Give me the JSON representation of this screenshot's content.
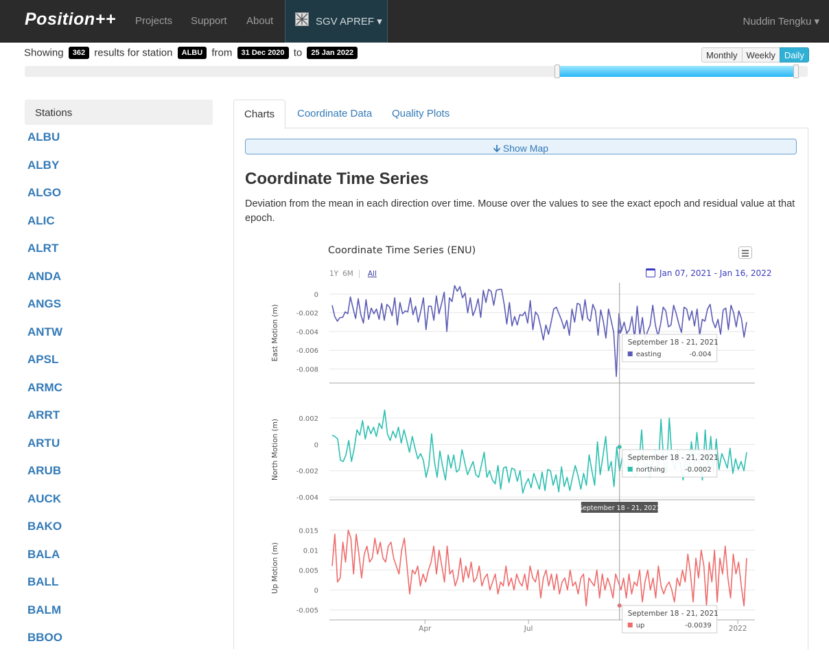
{
  "navbar": {
    "brand": "Position++",
    "links": [
      "Projects",
      "Support",
      "About"
    ],
    "active_menu": "SGV APREF",
    "user": "Nuddin Tengku"
  },
  "filter": {
    "prefix": "Showing",
    "count": "362",
    "mid1": "results for station",
    "station": "ALBU",
    "mid2": "from",
    "from": "31 Dec 2020",
    "mid3": "to",
    "to": "25 Jan 2022",
    "granularity": [
      "Monthly",
      "Weekly",
      "Daily"
    ],
    "selected_granularity": "Daily",
    "range_selected_fraction": [
      0.68,
      0.985
    ]
  },
  "sidebar": {
    "header": "Stations",
    "stations": [
      "ALBU",
      "ALBY",
      "ALGO",
      "ALIC",
      "ALRT",
      "ANDA",
      "ANGS",
      "ANTW",
      "APSL",
      "ARMC",
      "ARRT",
      "ARTU",
      "ARUB",
      "AUCK",
      "BAKO",
      "BALA",
      "BALL",
      "BALM",
      "BBOO"
    ]
  },
  "tabs": [
    "Charts",
    "Coordinate Data",
    "Quality Plots"
  ],
  "active_tab": "Charts",
  "map_button": "Show Map",
  "main": {
    "title": "Coordinate Time Series",
    "description": "Deviation from the mean in each direction over time. Mouse over the values to see the exact epoch and residual value at that epoch."
  },
  "chart_ui": {
    "range_buttons": [
      "1Y",
      "6M",
      "All"
    ],
    "selected_range": "All",
    "date_range": "Jan 07, 2021 - Jan 16, 2022",
    "menu_icon": "hamburger-menu-icon",
    "calendar_icon": "calendar-icon"
  },
  "chart_data": {
    "type": "line",
    "title": "Coordinate Time Series (ENU)",
    "x_range": [
      "2021-01-07",
      "2022-01-16"
    ],
    "x_ticks": [
      "Apr",
      "Jul",
      "2022"
    ],
    "crosshair_label": "September 18 - 21, 2021",
    "series": [
      {
        "name": "easting",
        "color": "#5b5bb5",
        "ylabel": "East Motion (m)",
        "yticks": [
          0,
          -0.002,
          -0.004,
          -0.006,
          -0.008
        ],
        "ylim": [
          -0.0095,
          0.0012
        ],
        "tooltip": {
          "date": "September 18 - 21, 2021",
          "name": "easting",
          "value": "-0.004"
        },
        "values": [
          -0.0012,
          -0.0024,
          -0.0029,
          -0.0025,
          -0.0025,
          -0.0019,
          -0.0021,
          -0.0003,
          -0.0015,
          -0.0026,
          -0.0005,
          -0.0022,
          -0.0031,
          -0.0006,
          -0.0027,
          -0.0015,
          -0.0021,
          -0.0016,
          -0.0027,
          -0.001,
          -0.0028,
          -0.0011,
          -0.0014,
          -0.0023,
          -0.0004,
          -0.0033,
          -0.0009,
          -0.0021,
          -0.0018,
          -0.0019,
          -0.0004,
          -0.0022,
          -0.0013,
          -0.003,
          -0.0018,
          -0.0004,
          -0.0038,
          -0.0013,
          -0.0013,
          -0.0028,
          -0.0002,
          -0.0021,
          -0.001,
          0.0002,
          -0.004,
          -0.0004,
          -0.0008,
          0.0009,
          0.0003,
          0.0008,
          -0.0004,
          0.0001,
          -0.002,
          -0.0004,
          -0.0023,
          -0.0016,
          -0.0005,
          -0.0025,
          0.0004,
          -0.0009,
          0.0005,
          0.0003,
          -0.0012,
          0.0004,
          0.0005,
          0.0005,
          -0.0011,
          -0.0032,
          -0.0009,
          -0.0034,
          -0.0024,
          -0.0033,
          -0.0022,
          -0.0023,
          -0.0019,
          -0.0031,
          -0.0007,
          -0.0038,
          -0.0019,
          -0.0023,
          -0.0035,
          -0.0049,
          -0.0033,
          -0.0043,
          -0.003,
          -0.0016,
          -0.0014,
          -0.0021,
          -0.0028,
          -0.0037,
          -0.0028,
          -0.0044,
          -0.0016,
          -0.003,
          -0.001,
          -0.0011,
          -0.0028,
          -0.0006,
          -0.0026,
          -0.0029,
          -0.0011,
          -0.0018,
          -0.0044,
          -0.0017,
          -0.0029,
          -0.0047,
          -0.0016,
          -0.0028,
          -0.0041,
          -0.0088,
          -0.0021,
          -0.0039,
          -0.003,
          -0.0042,
          -0.0038,
          -0.0024,
          -0.0047,
          -0.0013,
          -0.0044,
          -0.0025,
          -0.0048,
          -0.004,
          -0.0033,
          -0.0012,
          -0.0033,
          -0.0045,
          -0.0032,
          -0.0014,
          -0.0018,
          -0.0035,
          -0.0033,
          -0.0012,
          -0.0021,
          -0.0032,
          -0.0041,
          -0.0014,
          -0.0016,
          -0.0028,
          -0.0018,
          -0.0034,
          -0.0016,
          -0.0044,
          -0.0027,
          -0.0029,
          -0.0016,
          -0.0011,
          -0.0029,
          -0.0036,
          -0.0027,
          -0.0043,
          -0.0017,
          -0.0015,
          -0.0038,
          -0.0012,
          -0.002,
          -0.0035,
          -0.0018,
          -0.0026,
          -0.0046,
          -0.003
        ]
      },
      {
        "name": "northing",
        "color": "#2bbfb0",
        "ylabel": "North Motion (m)",
        "yticks": [
          0.002,
          0,
          -0.002,
          -0.004
        ],
        "ylim": [
          -0.0042,
          0.0034
        ],
        "tooltip": {
          "date": "September 18 - 21, 2021",
          "name": "northing",
          "value": "-0.0002"
        },
        "values": [
          0.0007,
          0.0006,
          0.0004,
          -0.0012,
          -0.0013,
          -0.0008,
          0.0003,
          -0.0013,
          -0.0003,
          0.0011,
          0.0007,
          0.0018,
          0.0004,
          0.0014,
          0.0008,
          0.0013,
          0.0006,
          0.0016,
          0.0012,
          0.0026,
          0.0008,
          0.0003,
          0.001,
          0.0005,
          0.0013,
          0.0001,
          0.0011,
          0.0003,
          -0.0006,
          0.0006,
          -0.0003,
          -0.0011,
          -0.0007,
          -0.0012,
          -0.0025,
          -0.0016,
          0.0008,
          -0.0013,
          -0.0025,
          -0.0005,
          -0.0017,
          -0.0027,
          -0.0008,
          -0.0018,
          -0.0008,
          -0.0021,
          -0.0019,
          -0.0004,
          -0.0014,
          -0.0023,
          -0.0018,
          -0.0013,
          -0.0023,
          -0.0025,
          -0.0016,
          -0.0006,
          -0.0025,
          -0.002,
          -0.0027,
          -0.003,
          -0.0016,
          -0.0034,
          -0.0018,
          -0.0017,
          -0.0029,
          -0.0018,
          -0.0019,
          -0.0028,
          -0.002,
          -0.0037,
          -0.003,
          -0.0026,
          -0.0033,
          -0.0022,
          -0.0028,
          -0.0034,
          -0.0021,
          -0.0035,
          -0.0019,
          -0.002,
          -0.0031,
          -0.0023,
          -0.0036,
          -0.0017,
          -0.0032,
          -0.0025,
          -0.0035,
          -0.0025,
          -0.0016,
          -0.0024,
          -0.0034,
          -0.0022,
          -0.0031,
          -0.0008,
          -0.002,
          -0.0031,
          0.0002,
          -0.0023,
          -0.0009,
          0.0006,
          -0.002,
          -0.0013,
          -0.0032,
          -0.0002,
          -0.002,
          -0.001,
          -0.0017,
          -0.0018,
          -0.0005,
          -0.0023,
          -0.0024,
          -0.0015,
          0.0011,
          -0.0021,
          -0.0014,
          -0.0025,
          -0.0012,
          -0.0004,
          -0.002,
          0.0019,
          -0.0014,
          -0.0022,
          0.002,
          -0.0012,
          -0.0019,
          -0.0004,
          -0.0015,
          -0.0027,
          -0.0007,
          -0.0023,
          0.0002,
          -0.0016,
          0.0009,
          -0.0014,
          -0.0027,
          0.0011,
          -0.0019,
          0.0006,
          -0.0021,
          0.0004,
          -0.0019,
          -0.0007,
          -0.0012,
          -0.0018,
          -0.0003,
          -0.0022,
          -0.0011,
          -0.0019,
          -0.0013,
          -0.002,
          -0.0006
        ]
      },
      {
        "name": "up",
        "color": "#ee6b6b",
        "ylabel": "Up Motion (m)",
        "yticks": [
          0.015,
          0.01,
          0.005,
          0,
          -0.005
        ],
        "ylim": [
          -0.0075,
          0.0185
        ],
        "tooltip": {
          "date": "September 18 - 21, 2021",
          "name": "up",
          "value": "-0.0039"
        },
        "values": [
          0.006,
          0.014,
          0.002,
          0.003,
          0.012,
          0.007,
          0.015,
          0.013,
          0.004,
          0.014,
          0.009,
          0.003,
          0.009,
          0.011,
          0.007,
          0.008,
          0.013,
          0.009,
          0.012,
          0.008,
          0.007,
          0.011,
          0.012,
          0.008,
          0.006,
          0.004,
          0.01,
          0.013,
          0.006,
          -0.001,
          0.005,
          0.004,
          0.006,
          0.001,
          0.004,
          0.002,
          0.005,
          0.007,
          0.011,
          0.004,
          0.01,
          0.006,
          0.002,
          0.011,
          0.004,
          0.005,
          0.001,
          0.003,
          0.008,
          0.002,
          0.006,
          0.003,
          0.007,
          0.002,
          0.003,
          0.006,
          0.001,
          0.003,
          0.004,
          0.0,
          0.002,
          0.004,
          -0.001,
          0.002,
          0.001,
          0.006,
          0.001,
          0.003,
          0.0,
          0.004,
          0.002,
          0.001,
          0.004,
          0.0,
          0.006,
          0.003,
          0.002,
          0.005,
          -0.002,
          0.003,
          0.005,
          0.001,
          0.004,
          0.0,
          0.004,
          -0.001,
          0.002,
          0.003,
          0.0,
          0.005,
          0.001,
          0.002,
          -0.001,
          0.003,
          0.004,
          -0.004,
          0.003,
          0.002,
          0.001,
          0.005,
          -0.002,
          0.004,
          0.0,
          0.003,
          0.001,
          -0.002,
          0.004,
          0.002,
          0.0,
          0.003,
          -0.002,
          0.004,
          -0.001,
          0.002,
          0.001,
          0.005,
          -0.003,
          0.002,
          0.005,
          0.0,
          0.003,
          -0.002,
          0.006,
          0.001,
          -0.001,
          0.001,
          0.002,
          0.0,
          -0.003,
          0.003,
          0.001,
          0.005,
          0.002,
          0.009,
          0.004,
          -0.003,
          0.008,
          0.003,
          0.01,
          0.006,
          -0.004,
          0.007,
          0.002,
          0.01,
          -0.003,
          0.008,
          0.004,
          0.011,
          0.003,
          -0.002,
          0.009,
          0.004,
          0.007,
          0.001,
          -0.004,
          0.008
        ]
      }
    ]
  }
}
